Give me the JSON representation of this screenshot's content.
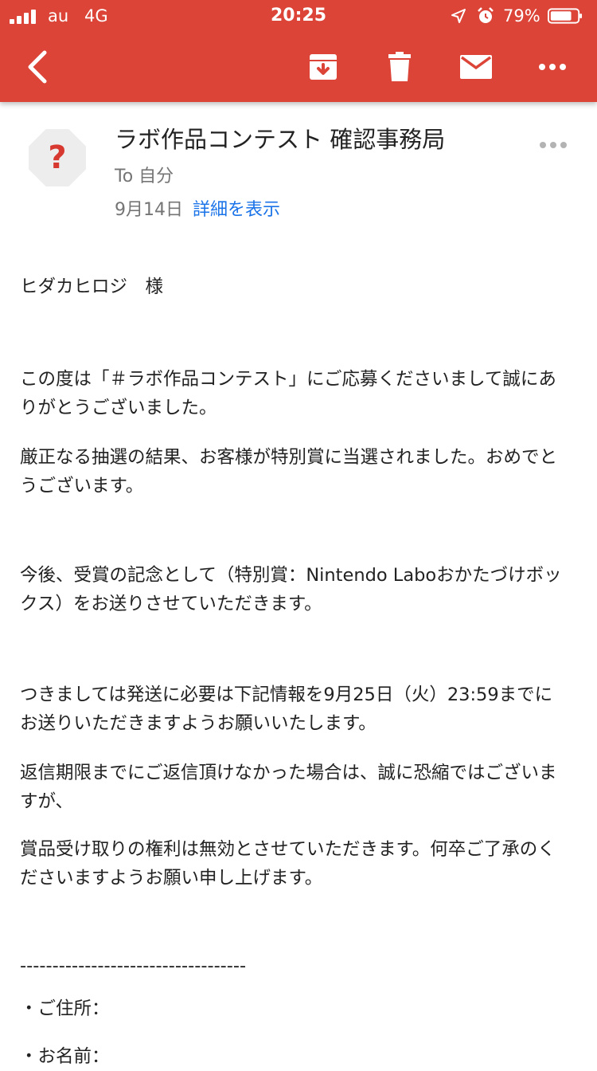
{
  "status_bar": {
    "carrier": "au",
    "network": "4G",
    "time": "20:25",
    "battery": "79%",
    "battery_level": 0.79
  },
  "toolbar": {
    "icons": [
      "back-arrow-icon",
      "archive-icon",
      "trash-icon",
      "mail-icon",
      "more-icon"
    ]
  },
  "email": {
    "sender": "ラボ作品コンテスト 確認事務局",
    "to": "To 自分",
    "date": "9月14日",
    "details_link": "詳細を表示",
    "avatar": "?"
  },
  "body": {
    "lines": [
      "ヒダカヒロジ　様",
      "この度は「＃ラボ作品コンテスト」にご応募くださいまして誠にあ",
      "りがとうございました。",
      "厳正なる抽選の結果、お客様が特別賞に当選されました。おめでと",
      "うございます。",
      "今後、受賞の記念として（特別賞：Nintendo Laboおかたづけボッ",
      "クス）をお送りさせていただきます。",
      "つきましては発送に必要は下記情報を9月25日（火）23:59までに",
      "お送りいただきますようお願いいたします。",
      "返信期限までにご返信頂けなかった場合は、誠に恐縮ではございま",
      "すが、",
      "賞品受け取りの権利は無効とさせていただきます。何卒ご了承のく",
      "ださいますようお願い申し上げます。",
      "-----------------------------------",
      "・ご住所：",
      "・お名前："
    ]
  },
  "colors": {
    "bar": "#db4437",
    "link": "#1a73e8",
    "avatar_mark": "#d7382f"
  }
}
